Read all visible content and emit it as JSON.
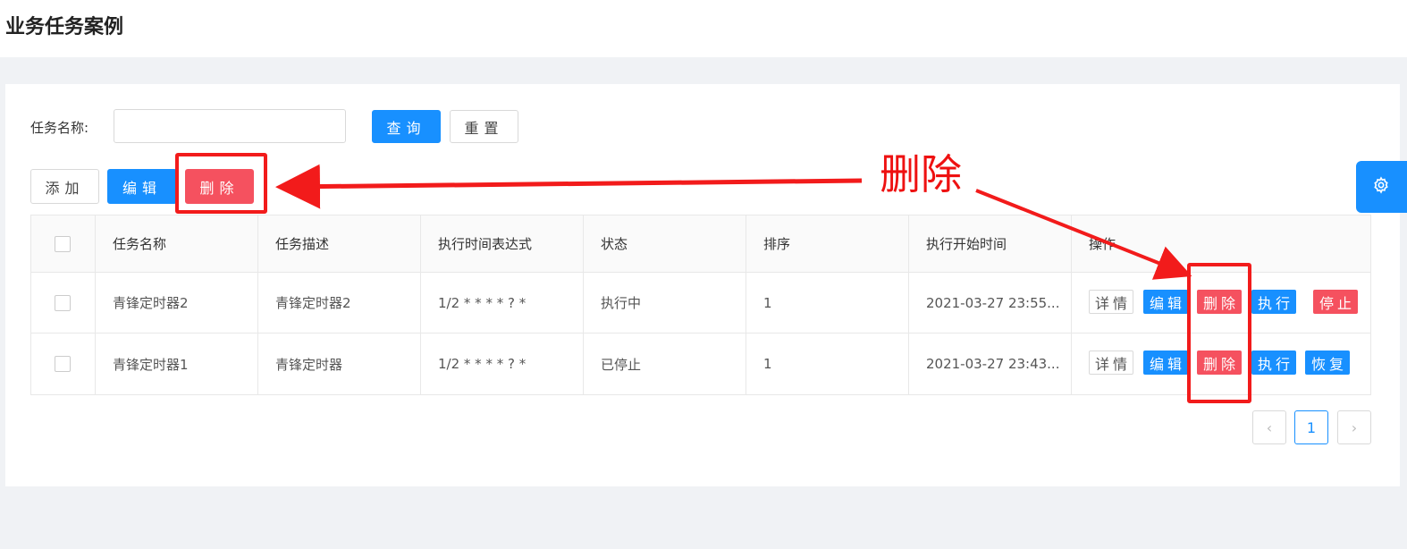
{
  "page": {
    "title": "业务任务案例"
  },
  "search": {
    "label": "任务名称:",
    "value": "",
    "placeholder": "",
    "query_btn": "查询",
    "reset_btn": "重置"
  },
  "toolbar": {
    "add": "添加",
    "edit": "编辑",
    "delete": "删除"
  },
  "table": {
    "headers": [
      "任务名称",
      "任务描述",
      "执行时间表达式",
      "状态",
      "排序",
      "执行开始时间",
      "操作"
    ],
    "rows": [
      {
        "name": "青锋定时器2",
        "desc": "青锋定时器2",
        "cron": "1/2 * * * * ? *",
        "status": "执行中",
        "sort": "1",
        "start": "2021-03-27 23:55...",
        "ops": {
          "detail": "详情",
          "edit": "编辑",
          "delete": "删除",
          "run": "执行",
          "toggle": "停止"
        }
      },
      {
        "name": "青锋定时器1",
        "desc": "青锋定时器",
        "cron": "1/2 * * * * ? *",
        "status": "已停止",
        "sort": "1",
        "start": "2021-03-27 23:43...",
        "ops": {
          "detail": "详情",
          "edit": "编辑",
          "delete": "删除",
          "run": "执行",
          "toggle": "恢复"
        }
      }
    ]
  },
  "pagination": {
    "prev": "‹",
    "current": "1",
    "next": "›"
  },
  "annotation": {
    "text": "删除"
  },
  "icons": {
    "settings": "gear-icon"
  },
  "colors": {
    "primary": "#1890ff",
    "danger": "#f5515f",
    "annotation": "#f21b1b"
  }
}
